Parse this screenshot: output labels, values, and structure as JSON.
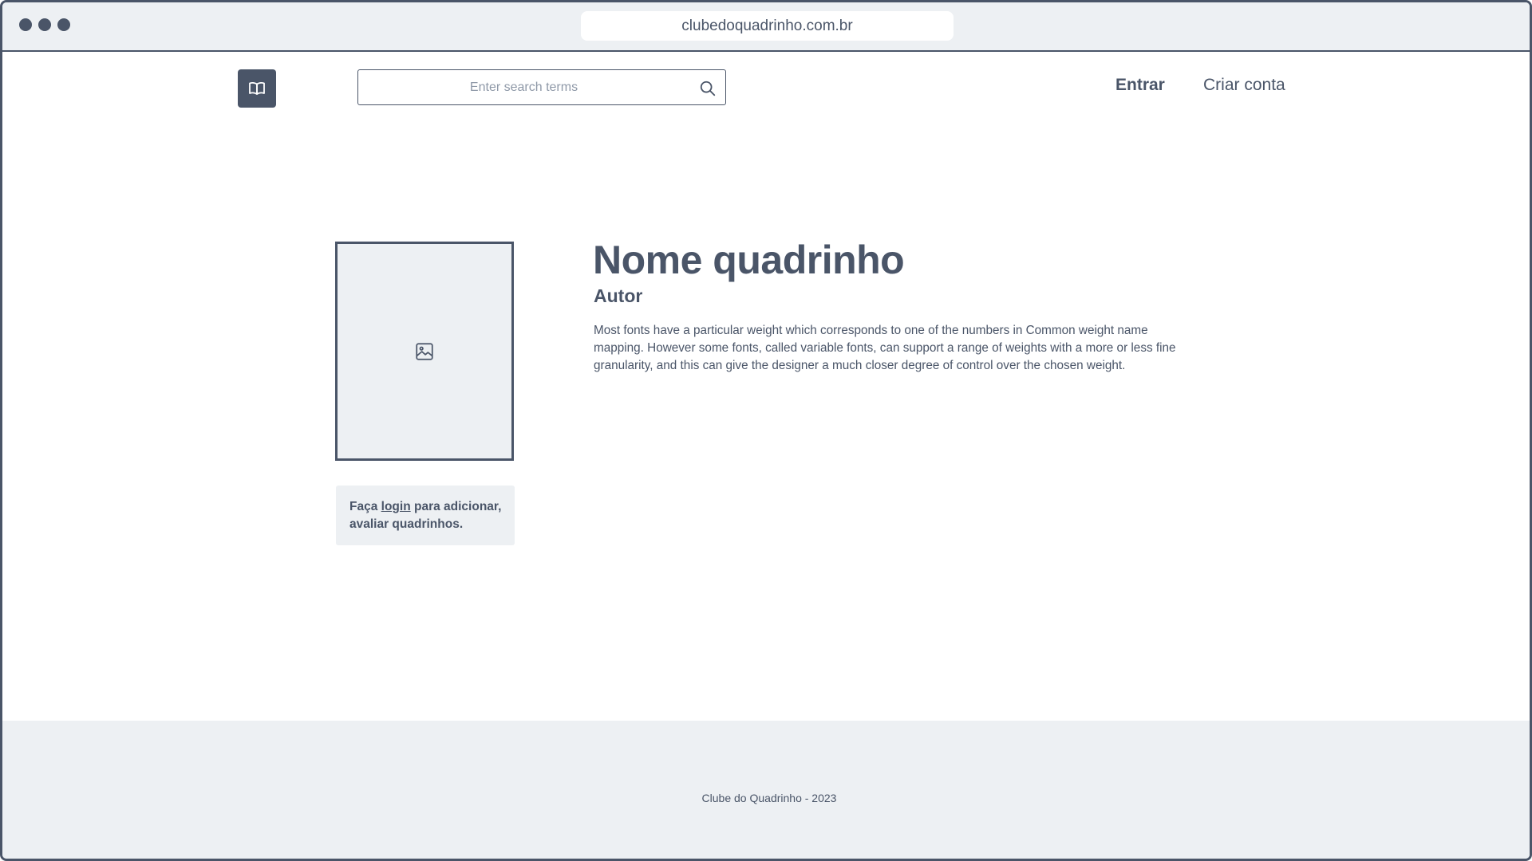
{
  "browser": {
    "url": "clubedoquadrinho.com.br"
  },
  "header": {
    "logo_icon": "open-book-icon",
    "search_placeholder": "Enter search terms",
    "search_icon": "magnifier-icon",
    "login_label": "Entrar",
    "signup_label": "Criar conta"
  },
  "comic": {
    "cover_icon": "image-placeholder-icon",
    "title": "Nome quadrinho",
    "author": "Autor",
    "description": "Most fonts have a particular weight which corresponds to one of the numbers in Common weight name mapping. However some fonts, called variable fonts, can support a range of weights with a more or less fine granularity, and this can give the designer a much closer degree of control over the chosen weight."
  },
  "login_prompt": {
    "prefix": "Faça ",
    "link_label": "login",
    "suffix": " para adicionar, avaliar quadrinhos."
  },
  "footer": {
    "text": "Clube do Quadrinho - 2023"
  },
  "colors": {
    "primary": "#4a5568",
    "surface": "#edf0f3",
    "background": "#ffffff"
  }
}
